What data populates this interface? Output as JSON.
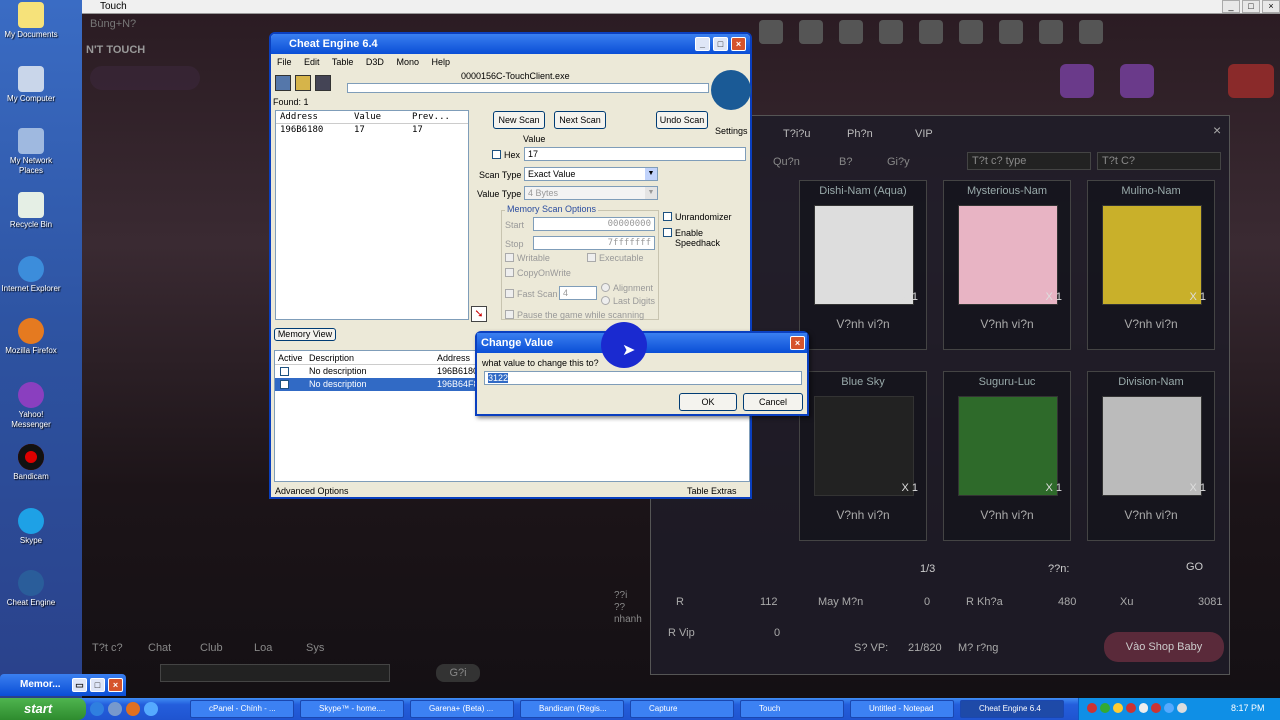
{
  "desktop": {
    "icons": [
      "My Documents",
      "My Computer",
      "My Network Places",
      "Recycle Bin",
      "Internet Explorer",
      "Mozilla Firefox",
      "Yahoo! Messenger",
      "Bandicam",
      "Skype",
      "Cheat Engine"
    ]
  },
  "game": {
    "window_title": "Touch",
    "top_left_text": "Bùng+N?",
    "dont_touch": "N'T TOUCH",
    "tabs": [
      "T?i?u",
      "Ph?n",
      "VIP"
    ],
    "filters": [
      "Qu?n",
      "B?",
      "Gi?y"
    ],
    "type_select": "T?t c? type",
    "all_select": "T?t C?",
    "items_row1": [
      "Dishi-Nam (Aqua)",
      "Mysterious-Nam",
      "Mulino-Nam"
    ],
    "items_row2": [
      "Blue Sky",
      "Suguru-Luc",
      "Division-Nam"
    ],
    "item_count": "X 1",
    "forever": "V?nh vi?n",
    "page": "1/3",
    "den_label": "??n:",
    "go": "GO",
    "stats": {
      "r_label": "R",
      "r_val": "112",
      "may_man": "May M?n",
      "may_man_val": "0",
      "r_khoa": "R Kh?a",
      "r_khoa_val": "480",
      "xu": "Xu",
      "xu_val": "3081",
      "r_vip": "R Vip",
      "r_vip_val": "0",
      "so_vp": "S? VP:",
      "so_vp_val": "21/820",
      "mo_rong": "M? r?ng",
      "vao_shop": "Vào Shop Baby"
    },
    "chat_tabs": [
      "T?t c?",
      "Chat",
      "Club",
      "Loa",
      "Sys"
    ],
    "send": "G?i",
    "side_text": "??i ?? nhanh"
  },
  "cheat_engine": {
    "title": "Cheat Engine 6.4",
    "menu": [
      "File",
      "Edit",
      "Table",
      "D3D",
      "Mono",
      "Help"
    ],
    "process": "0000156C-TouchClient.exe",
    "found": "Found: 1",
    "list_headers": [
      "Address",
      "Value",
      "Prev..."
    ],
    "list_rows": [
      [
        "196B6180",
        "17",
        "17"
      ]
    ],
    "new_scan": "New Scan",
    "next_scan": "Next Scan",
    "undo_scan": "Undo Scan",
    "settings": "Settings",
    "value_label": "Value",
    "hex_label": "Hex",
    "value_input": "17",
    "scan_type_label": "Scan Type",
    "scan_type": "Exact Value",
    "value_type_label": "Value Type",
    "value_type": "4 Bytes",
    "memory_scan_options": "Memory Scan Options",
    "start_label": "Start",
    "start_value": "00000000",
    "stop_label": "Stop",
    "stop_value": "7fffffff",
    "writable": "Writable",
    "executable": "Executable",
    "copy_on_write": "CopyOnWrite",
    "fast_scan": "Fast Scan",
    "fast_scan_value": "4",
    "alignment": "Alignment",
    "last_digits": "Last Digits",
    "pause_game": "Pause the game while scanning",
    "unrandomizer": "Unrandomizer",
    "enable_speedhack": "Enable Speedhack",
    "memory_view": "Memory View",
    "table_headers": [
      "Active",
      "Description",
      "Address"
    ],
    "table_rows": [
      [
        "No description",
        "196B6180"
      ],
      [
        "No description",
        "196B64F8"
      ]
    ],
    "advanced_options": "Advanced Options",
    "table_extras": "Table Extras"
  },
  "dialog": {
    "title": "Change Value",
    "prompt": "what value to change this to?",
    "value": "3122",
    "ok": "OK",
    "cancel": "Cancel"
  },
  "memo_tab": "Memor...",
  "taskbar": {
    "start": "start",
    "tasks": [
      "cPanel - Chính - ...",
      "Skype™ - home....",
      "Garena+ (Beta) ...",
      "Bandicam (Regis...",
      "Capture",
      "Touch",
      "Untitled - Notepad",
      "Cheat Engine 6.4"
    ],
    "clock": "8:17 PM"
  }
}
